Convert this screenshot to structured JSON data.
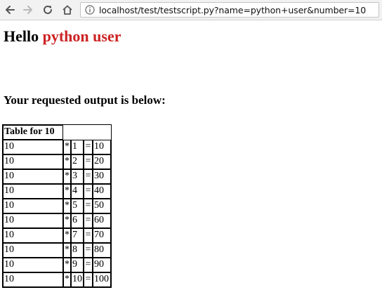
{
  "browser": {
    "url": "localhost/test/testscript.py?name=python+user&number=10"
  },
  "page": {
    "greeting_prefix": "Hello",
    "greeting_name": "python user",
    "subheading": "Your requested output is below:",
    "table": {
      "header": "Table for 10",
      "rows": [
        {
          "a": "10",
          "op": "*",
          "b": "1",
          "eq": "=",
          "result": "10"
        },
        {
          "a": "10",
          "op": "*",
          "b": "2",
          "eq": "=",
          "result": "20"
        },
        {
          "a": "10",
          "op": "*",
          "b": "3",
          "eq": "=",
          "result": "30"
        },
        {
          "a": "10",
          "op": "*",
          "b": "4",
          "eq": "=",
          "result": "40"
        },
        {
          "a": "10",
          "op": "*",
          "b": "5",
          "eq": "=",
          "result": "50"
        },
        {
          "a": "10",
          "op": "*",
          "b": "6",
          "eq": "=",
          "result": "60"
        },
        {
          "a": "10",
          "op": "*",
          "b": "7",
          "eq": "=",
          "result": "70"
        },
        {
          "a": "10",
          "op": "*",
          "b": "8",
          "eq": "=",
          "result": "80"
        },
        {
          "a": "10",
          "op": "*",
          "b": "9",
          "eq": "=",
          "result": "90"
        },
        {
          "a": "10",
          "op": "*",
          "b": "10",
          "eq": "=",
          "result": "100"
        }
      ]
    }
  },
  "icons": {
    "back": "back-arrow-icon",
    "forward": "forward-arrow-icon",
    "reload": "reload-icon",
    "home": "home-icon",
    "info": "info-icon"
  },
  "colors": {
    "name_highlight": "#cc2222"
  }
}
